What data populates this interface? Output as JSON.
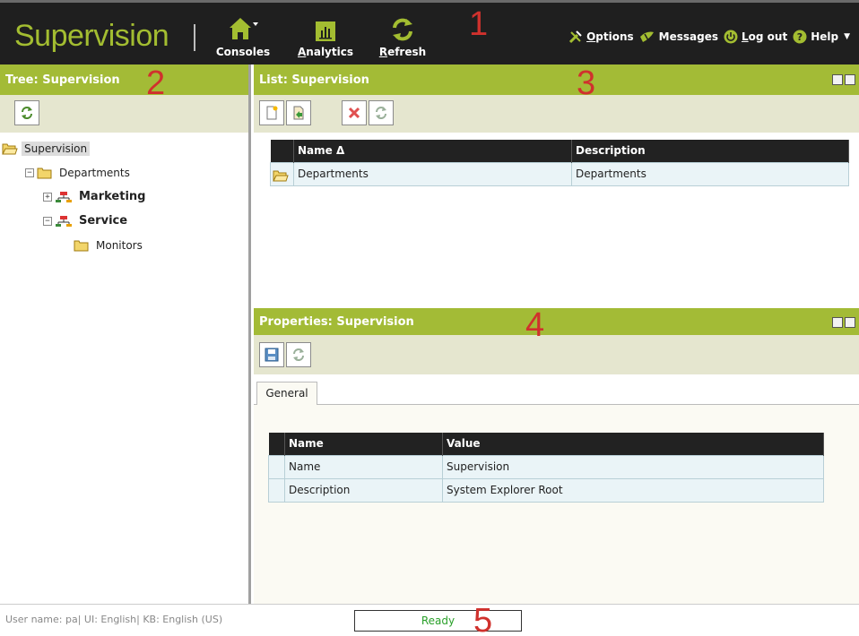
{
  "header": {
    "brand": "Supervision",
    "tools": [
      {
        "label": "Consoles",
        "underline": ""
      },
      {
        "label": "nalytics",
        "underline": "A"
      },
      {
        "label": "efresh",
        "underline": "R"
      }
    ],
    "right_menu": {
      "options": "ptions",
      "options_ul": "O",
      "messages": "Messages",
      "logout": "og out",
      "logout_ul": "L",
      "help": "Help"
    }
  },
  "markers": [
    "1",
    "2",
    "3",
    "4",
    "5"
  ],
  "tree_panel": {
    "title": "Tree: Supervision",
    "items": [
      {
        "label": "Supervision"
      },
      {
        "label": "Departments",
        "expander": "−"
      },
      {
        "label": "Marketing",
        "expander": "+"
      },
      {
        "label": "Service",
        "expander": "−"
      },
      {
        "label": "Monitors"
      }
    ]
  },
  "list_panel": {
    "title": "List: Supervision",
    "columns": [
      "Name Δ",
      "Description"
    ],
    "rows": [
      {
        "name": "Departments",
        "description": "Departments"
      }
    ]
  },
  "properties_panel": {
    "title": "Properties: Supervision",
    "tab": "General",
    "columns": [
      "Name",
      "Value"
    ],
    "rows": [
      {
        "name": "Name",
        "value": "Supervision"
      },
      {
        "name": "Description",
        "value": "System Explorer Root"
      }
    ]
  },
  "status": {
    "user_info": "User name: pa| UI: English| KB: English (US)",
    "state": "Ready"
  },
  "colors": {
    "accent_green": "#a3bb36",
    "header_bg": "#1f1f1f",
    "marker_red": "#d0312d",
    "ready_green": "#2aa02a"
  }
}
